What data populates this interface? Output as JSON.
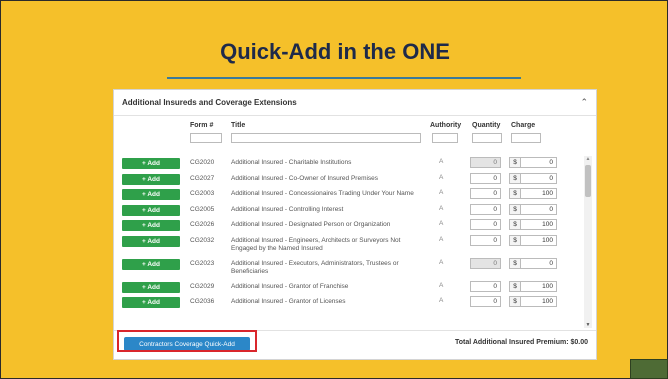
{
  "slide": {
    "title": "Quick-Add in the ONE"
  },
  "panel": {
    "title": "Additional Insureds and Coverage Extensions",
    "columns": {
      "form": "Form #",
      "title": "Title",
      "authority": "Authority",
      "quantity": "Quantity",
      "charge": "Charge"
    },
    "add_label": "+ Add",
    "currency": "$",
    "rows": [
      {
        "form": "CG2020",
        "title": "Additional Insured - Charitable Institutions",
        "authority": "A",
        "quantity": "0",
        "quantity_disabled": true,
        "charge": "0"
      },
      {
        "form": "CG2027",
        "title": "Additional Insured - Co-Owner of Insured Premises",
        "authority": "A",
        "quantity": "0",
        "quantity_disabled": false,
        "charge": "0"
      },
      {
        "form": "CG2003",
        "title": "Additional Insured - Concessionaires Trading Under Your Name",
        "authority": "A",
        "quantity": "0",
        "quantity_disabled": false,
        "charge": "100"
      },
      {
        "form": "CG2005",
        "title": "Additional Insured - Controlling Interest",
        "authority": "A",
        "quantity": "0",
        "quantity_disabled": false,
        "charge": "0"
      },
      {
        "form": "CG2026",
        "title": "Additional Insured - Designated Person or Organization",
        "authority": "A",
        "quantity": "0",
        "quantity_disabled": false,
        "charge": "100"
      },
      {
        "form": "CG2032",
        "title": "Additional Insured - Engineers, Architects or Surveyors Not Engaged by the Named Insured",
        "authority": "A",
        "quantity": "0",
        "quantity_disabled": false,
        "charge": "100"
      },
      {
        "form": "CG2023",
        "title": "Additional Insured - Executors, Administrators, Trustees or Beneficiaries",
        "authority": "A",
        "quantity": "0",
        "quantity_disabled": true,
        "charge": "0"
      },
      {
        "form": "CG2029",
        "title": "Additional Insured - Grantor of Franchise",
        "authority": "A",
        "quantity": "0",
        "quantity_disabled": false,
        "charge": "100"
      },
      {
        "form": "CG2036",
        "title": "Additional Insured - Grantor of Licenses",
        "authority": "A",
        "quantity": "0",
        "quantity_disabled": false,
        "charge": "100"
      }
    ],
    "quick_add_label": "Contractors Coverage Quick-Add",
    "total_label": "Total Additional Insured Premium: $0.00"
  },
  "colors": {
    "background": "#f5c02a",
    "add_button": "#2fa04a",
    "quick_add_button": "#2b87c8",
    "highlight": "#d9262c"
  }
}
